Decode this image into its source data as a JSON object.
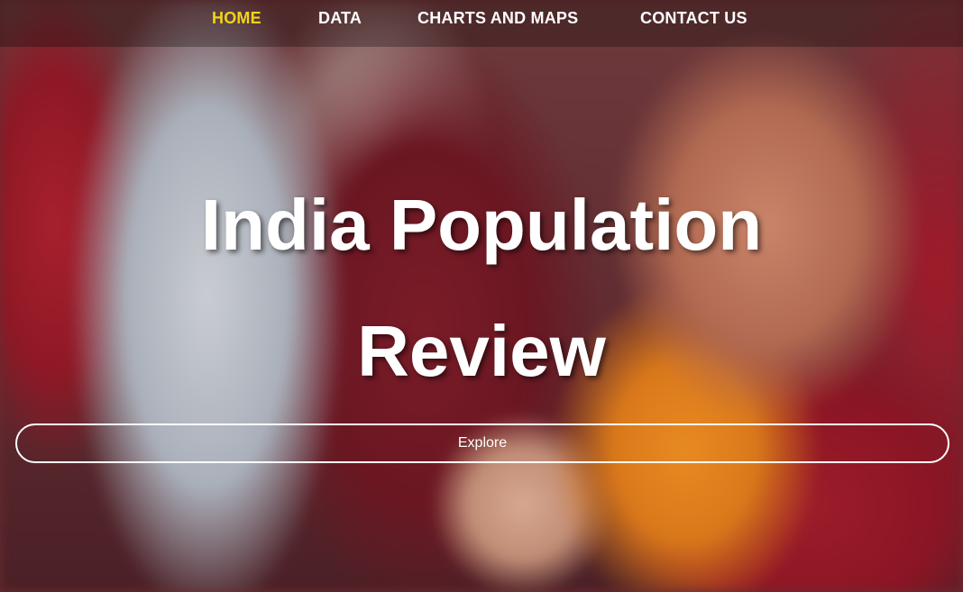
{
  "nav": {
    "items": [
      {
        "label": "HOME",
        "active": true
      },
      {
        "label": "DATA",
        "active": false
      },
      {
        "label": "CHARTS AND MAPS",
        "active": false
      },
      {
        "label": "CONTACT US",
        "active": false
      }
    ]
  },
  "hero": {
    "title_line1": "India Population",
    "title_line2": "Review",
    "explore_label": "Explore"
  },
  "colors": {
    "active_nav": "#f2d31b",
    "text": "#ffffff"
  }
}
